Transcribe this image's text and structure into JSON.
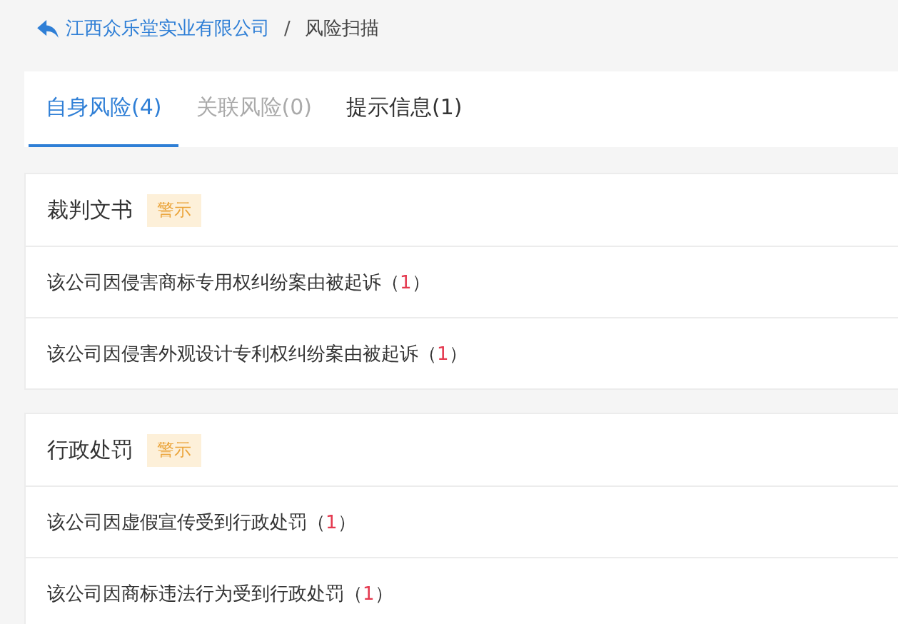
{
  "breadcrumb": {
    "back": "江西众乐堂实业有限公司",
    "separator": "/",
    "current": "风险扫描"
  },
  "tabs": [
    {
      "label": "自身风险(4)",
      "selected": true,
      "disabled": false
    },
    {
      "label": "关联风险(0)",
      "selected": false,
      "disabled": true
    },
    {
      "label": "提示信息(1)",
      "selected": false,
      "disabled": false
    }
  ],
  "sections": [
    {
      "title": "裁判文书",
      "tag": "警示",
      "items": [
        {
          "text": "该公司因侵害商标专用权纠纷案由被起诉",
          "open": "（",
          "count": "1",
          "close": "）"
        },
        {
          "text": "该公司因侵害外观设计专利权纠纷案由被起诉",
          "open": "（",
          "count": "1",
          "close": "）"
        }
      ]
    },
    {
      "title": "行政处罚",
      "tag": "警示",
      "items": [
        {
          "text": "该公司因虚假宣传受到行政处罚",
          "open": "（",
          "count": "1",
          "close": "）"
        },
        {
          "text": "该公司因商标违法行为受到行政处罚",
          "open": "（",
          "count": "1",
          "close": "）"
        }
      ]
    }
  ]
}
